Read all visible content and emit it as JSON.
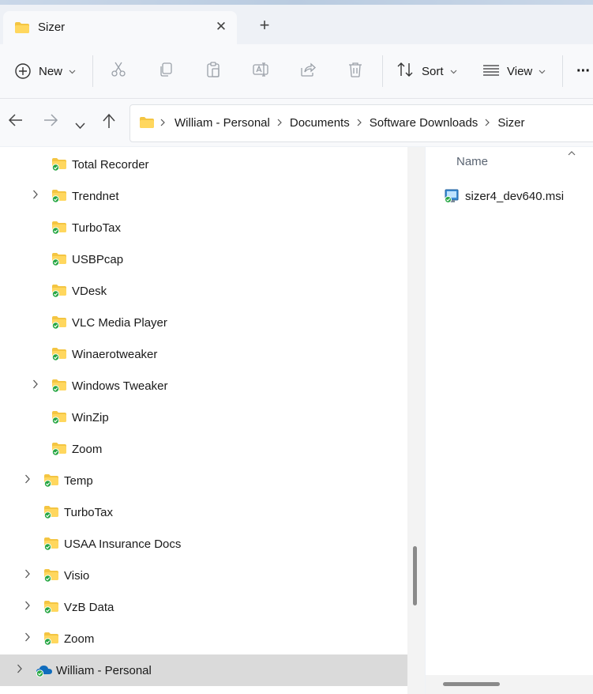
{
  "window": {
    "tab_title": "Sizer",
    "close_glyph": "✕",
    "new_tab_glyph": "+"
  },
  "toolbar": {
    "new_label": "New",
    "sort_label": "Sort",
    "view_label": "View",
    "more_glyph": "···",
    "icons": [
      "add-icon",
      "cut-icon",
      "copy-icon",
      "paste-icon",
      "rename-icon",
      "share-icon",
      "delete-icon",
      "sort-icon",
      "view-icon",
      "more-icon"
    ]
  },
  "address": {
    "back_glyph": "←",
    "forward_glyph": "→",
    "recent_glyph": "⌄",
    "up_glyph": "↑",
    "crumbs": [
      "William - Personal",
      "Documents",
      "Software Downloads",
      "Sizer"
    ]
  },
  "tree": {
    "items": [
      {
        "label": "Total Recorder",
        "expandable": false,
        "level": 2
      },
      {
        "label": "Trendnet",
        "expandable": true,
        "level": 2
      },
      {
        "label": "TurboTax",
        "expandable": false,
        "level": 2
      },
      {
        "label": "USBPcap",
        "expandable": false,
        "level": 2
      },
      {
        "label": "VDesk",
        "expandable": false,
        "level": 2
      },
      {
        "label": "VLC Media Player",
        "expandable": false,
        "level": 2
      },
      {
        "label": "Winaerotweaker",
        "expandable": false,
        "level": 2
      },
      {
        "label": "Windows Tweaker",
        "expandable": true,
        "level": 2
      },
      {
        "label": "WinZip",
        "expandable": false,
        "level": 2
      },
      {
        "label": "Zoom",
        "expandable": false,
        "level": 2
      },
      {
        "label": "Temp",
        "expandable": true,
        "level": 1
      },
      {
        "label": "TurboTax",
        "expandable": false,
        "level": 1
      },
      {
        "label": "USAA Insurance Docs",
        "expandable": false,
        "level": 1
      },
      {
        "label": "Visio",
        "expandable": true,
        "level": 1
      },
      {
        "label": "VzB Data",
        "expandable": true,
        "level": 1
      },
      {
        "label": "Zoom",
        "expandable": true,
        "level": 1
      },
      {
        "label": "William - Personal",
        "expandable": true,
        "level": 0,
        "selected": true,
        "icon": "onedrive-cloud-icon"
      }
    ]
  },
  "content": {
    "column_header": "Name",
    "sort_indicator": "^",
    "files": [
      {
        "name": "sizer4_dev640.msi",
        "icon": "msi-installer-icon"
      }
    ]
  },
  "colors": {
    "folder": "#f4c542",
    "sync_check": "#27a744",
    "selection": "#dadada"
  }
}
